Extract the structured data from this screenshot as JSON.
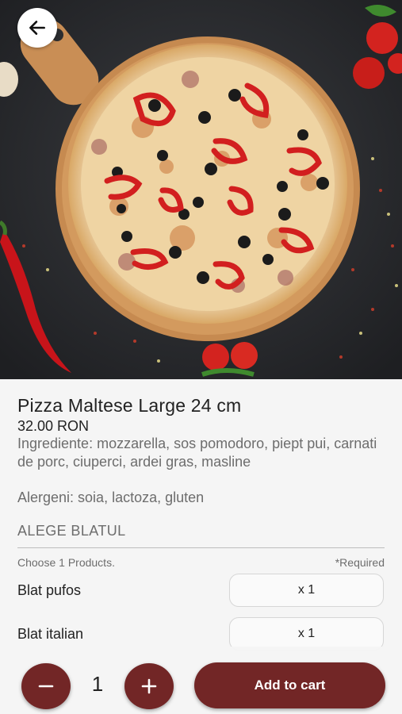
{
  "product": {
    "title": "Pizza Maltese Large 24 cm",
    "price": "32.00 RON",
    "ingredients": "Ingrediente: mozzarella, sos pomodoro, piept pui, carnati de porc, ciuperci, ardei gras, masline",
    "allergens": "Alergeni: soia, lactoza, gluten"
  },
  "options_section": {
    "title": "ALEGE BLATUL",
    "instruction": "Choose 1 Products.",
    "required_label": "*Required",
    "items": [
      {
        "name": "Blat pufos",
        "quantity": "x 1"
      },
      {
        "name": "Blat italian",
        "quantity": "x 1"
      }
    ]
  },
  "cart": {
    "quantity": "1",
    "add_label": "Add to cart"
  },
  "icons": {
    "back": "arrow-left-icon",
    "decrease": "minus-icon",
    "increase": "plus-icon"
  },
  "colors": {
    "accent": "#722626",
    "background": "#f5f5f5"
  }
}
